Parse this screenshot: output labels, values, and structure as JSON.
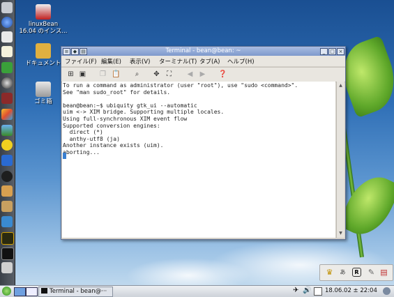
{
  "desktop": {
    "icons": [
      {
        "label_line1": "linuxBean",
        "label_line2": "16.04 のインス..."
      },
      {
        "label_line1": "ドキュメント",
        "label_line2": ""
      },
      {
        "label_line1": "ゴミ箱",
        "label_line2": ""
      }
    ]
  },
  "window": {
    "title": "Terminal - bean@bean: ~",
    "menus": [
      "ファイル(F)",
      "編集(E)",
      "表示(V)",
      "ターミナル(T)",
      "タブ(A)",
      "ヘルプ(H)"
    ],
    "terminal_text": "To run a command as administrator (user \"root\"), use \"sudo <command>\".\nSee \"man sudo_root\" for details.\n\nbean@bean:~$ ubiquity gtk_ui --automatic\nuim <-> XIM bridge. Supporting multiple locales.\nUsing full-synchronous XIM event flow\nSupported conversion engines:\n  direct (*)\n  anthy-utf8 (ja)\nAnother instance exists (uim).\naborting..."
  },
  "taskbar": {
    "task_label": "Terminal - bean@···",
    "clock": "18.06.02 ± 22:04"
  },
  "tray": {
    "ime_label": "R"
  }
}
